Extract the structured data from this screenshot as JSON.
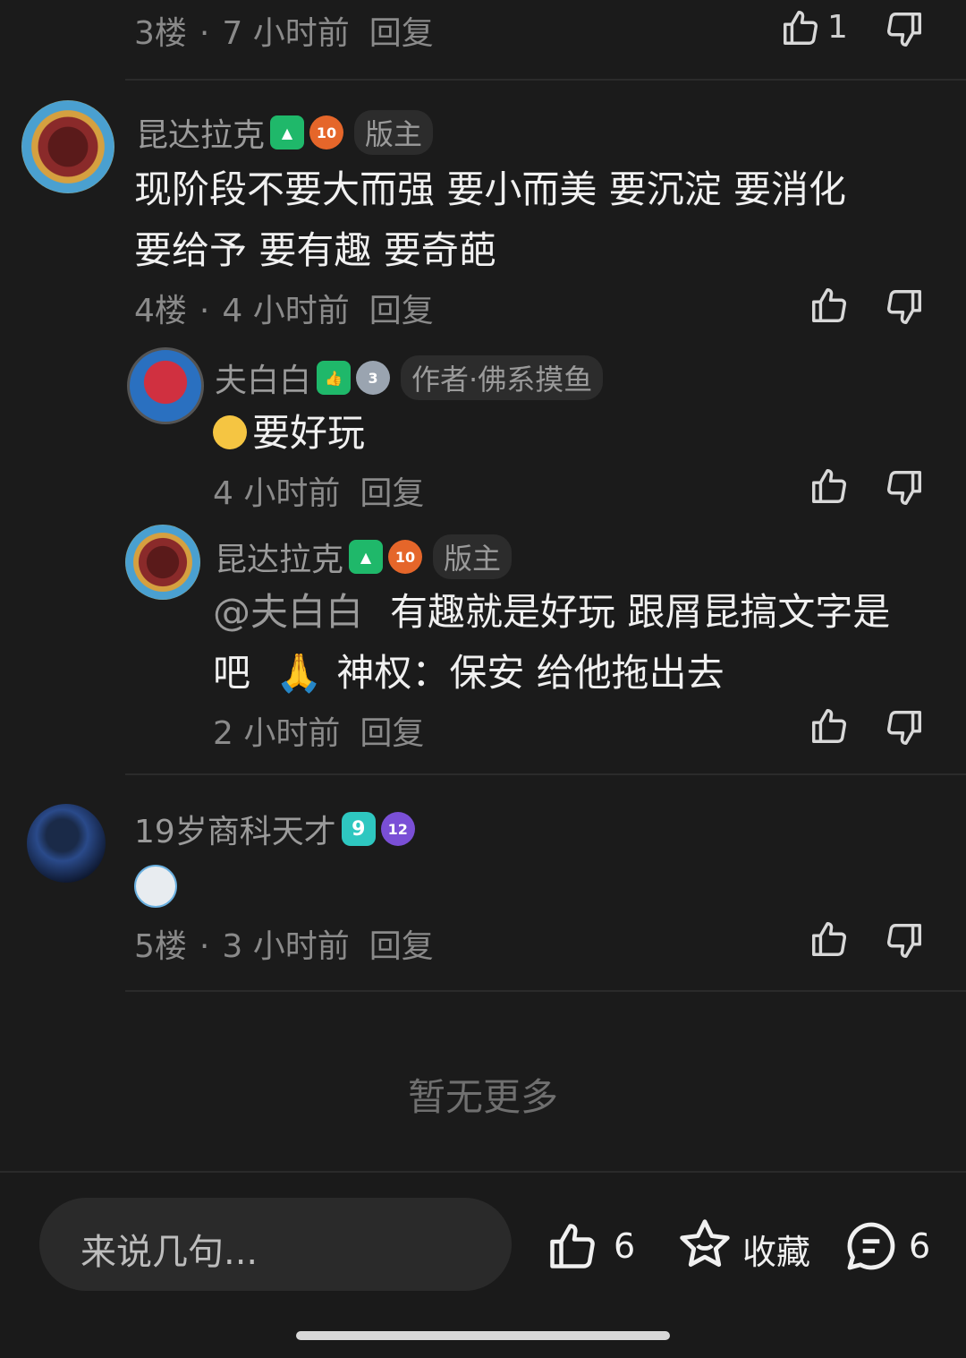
{
  "comments": [
    {
      "floor": "3楼",
      "time": "7 小时前",
      "reply": "回复",
      "likes": "1"
    },
    {
      "user": "昆达拉克",
      "badge": "10",
      "role": "版主",
      "text_line1": "现阶段不要大而强 要小而美 要沉淀 要消化",
      "text_line2": "要给予 要有趣 要奇葩",
      "floor": "4楼",
      "time": "4 小时前",
      "reply": "回复",
      "replies": [
        {
          "user": "夫白白",
          "badge": "3",
          "role": "作者·佛系摸鱼",
          "text": "要好玩",
          "time": "4 小时前",
          "reply": "回复"
        },
        {
          "user": "昆达拉克",
          "badge": "10",
          "role": "版主",
          "mention": "@夫白白",
          "text_line1": "有趣就是好玩 跟屑昆搞文字是",
          "text_line2a": "吧",
          "text_line2b": "神权：保安 给他拖出去",
          "time": "2 小时前",
          "reply": "回复"
        }
      ]
    },
    {
      "user": "19岁商科天才",
      "level": "9",
      "badge": "12",
      "floor": "5楼",
      "time": "3 小时前",
      "reply": "回复"
    }
  ],
  "end_text": "暂无更多",
  "bottom_bar": {
    "input_placeholder": "来说几句...",
    "like_count": "6",
    "favorite_label": "收藏",
    "comment_count": "6"
  },
  "colors": {
    "background": "#1b1b1b",
    "badge_green": "#1fb86a",
    "badge_orange": "#e5662a",
    "badge_purple": "#7a4fd6",
    "badge_cyan": "#2ec7c0"
  }
}
